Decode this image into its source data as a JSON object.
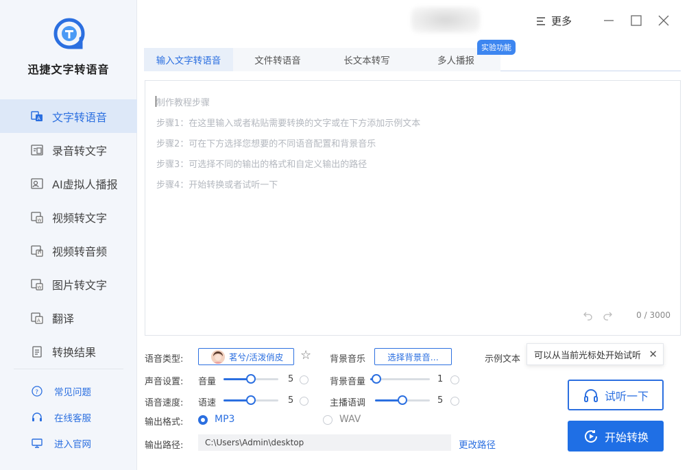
{
  "app": {
    "name": "迅捷文字转语音",
    "more_label": "更多"
  },
  "sidebar": {
    "items": [
      {
        "label": "文字转语音",
        "icon": "text-to-speech-icon",
        "active": true
      },
      {
        "label": "录音转文字",
        "icon": "recording-to-text-icon",
        "active": false
      },
      {
        "label": "AI虚拟人播报",
        "icon": "ai-avatar-icon",
        "active": false
      },
      {
        "label": "视频转文字",
        "icon": "video-to-text-icon",
        "active": false
      },
      {
        "label": "视频转音频",
        "icon": "video-to-audio-icon",
        "active": false
      },
      {
        "label": "图片转文字",
        "icon": "image-to-text-icon",
        "active": false
      },
      {
        "label": "翻译",
        "icon": "translate-icon",
        "active": false
      },
      {
        "label": "转换结果",
        "icon": "results-icon",
        "active": false
      }
    ],
    "support": [
      {
        "label": "常见问题",
        "icon": "help-icon"
      },
      {
        "label": "在线客服",
        "icon": "headset-icon"
      },
      {
        "label": "进入官网",
        "icon": "monitor-icon"
      }
    ]
  },
  "tabs": [
    {
      "label": "输入文字转语音",
      "active": true
    },
    {
      "label": "文件转语音",
      "active": false
    },
    {
      "label": "长文本转写",
      "active": false
    },
    {
      "label": "多人播报",
      "active": false
    }
  ],
  "experimental_badge": "实验功能",
  "editor": {
    "lines": [
      "制作教程步骤",
      "步骤1：在这里输入或者粘贴需要转换的文字或在下方添加示例文本",
      "步骤2：可在下方选择您想要的不同语音配置和背景音乐",
      "步骤3：可选择不同的输出的格式和自定义输出的路径",
      "步骤4：开始转换或者试听一下"
    ],
    "counter": "0 / 3000"
  },
  "settings": {
    "voice_type_label": "语音类型:",
    "voice_value": "茗兮/活泼俏皮",
    "bgm_label": "背景音乐",
    "bgm_button": "选择背景音...",
    "sample_text_label": "示例文本",
    "sound_label": "声音设置:",
    "volume_label": "音量",
    "volume_value": "5",
    "volume_level": 0.5,
    "bg_volume_label": "背景音量",
    "bg_volume_value": "1",
    "bg_volume_level": 0.1,
    "speed_section_label": "语音速度:",
    "speed_label": "语速",
    "speed_value": "5",
    "speed_level": 0.5,
    "pitch_label": "主播语调",
    "pitch_value": "5",
    "pitch_level": 0.5,
    "format_label": "输出格式:",
    "format_mp3": "MP3",
    "format_wav": "WAV",
    "format_selected": "MP3",
    "path_label": "输出路径:",
    "path_value": "C:\\Users\\Admin\\desktop",
    "change_path": "更改路径"
  },
  "tooltip": {
    "text": "可以从当前光标处开始试听"
  },
  "buttons": {
    "listen": "试听一下",
    "start": "开始转换"
  },
  "colors": {
    "accent": "#2b6fe0",
    "primary_button": "#1f6fe5",
    "sidebar_bg": "#f3f6fb",
    "active_nav_bg": "#dde8f8",
    "badge": "#3d86f0"
  }
}
